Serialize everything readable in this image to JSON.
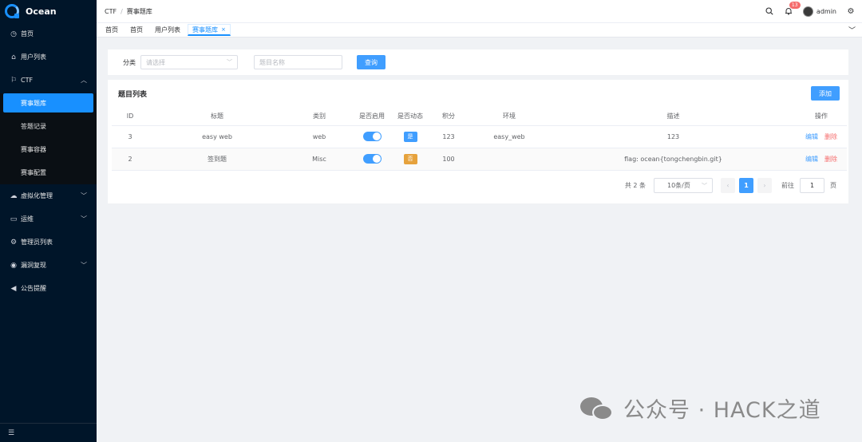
{
  "sidebar": {
    "logo_text": "Ocean",
    "items": [
      {
        "label": "首页",
        "icon": "dashboard-icon"
      },
      {
        "label": "用户列表",
        "icon": "home-icon"
      },
      {
        "label": "CTF",
        "icon": "flag-icon",
        "expanded": true,
        "children": [
          {
            "label": "赛事题库",
            "active": true
          },
          {
            "label": "答题记录"
          },
          {
            "label": "赛事容器"
          },
          {
            "label": "赛事配置"
          }
        ]
      },
      {
        "label": "虚拟化管理",
        "icon": "cloud-icon"
      },
      {
        "label": "运维",
        "icon": "monitor-icon"
      },
      {
        "label": "管理员列表",
        "icon": "gear-icon"
      },
      {
        "label": "漏洞复现",
        "icon": "bug-icon"
      },
      {
        "label": "公告提醒",
        "icon": "megaphone-icon"
      }
    ]
  },
  "header": {
    "breadcrumb": [
      "CTF",
      "赛事题库"
    ],
    "notification_count": "13",
    "username": "admin"
  },
  "tags": [
    {
      "label": "首页"
    },
    {
      "label": "首页"
    },
    {
      "label": "用户列表"
    },
    {
      "label": "赛事题库",
      "active": true,
      "close": "×"
    }
  ],
  "search": {
    "category_label": "分类",
    "category_placeholder": "请选择",
    "name_placeholder": "题目名称",
    "query_button": "查询"
  },
  "table": {
    "title": "题目列表",
    "add_button": "添加",
    "columns": [
      "ID",
      "标题",
      "类别",
      "是否启用",
      "是否动态",
      "积分",
      "环境",
      "描述",
      "操作"
    ],
    "rows": [
      {
        "id": "3",
        "title": "easy web",
        "category": "web",
        "enabled": true,
        "dynamic": "是",
        "score": "123",
        "env": "easy_web",
        "desc": "123",
        "edit": "编辑",
        "delete": "删除"
      },
      {
        "id": "2",
        "title": "签到题",
        "category": "Misc",
        "enabled": true,
        "dynamic": "否",
        "score": "100",
        "env": "",
        "desc": "flag: ocean{tongchengbin.git}",
        "edit": "编辑",
        "delete": "删除"
      }
    ]
  },
  "pagination": {
    "total_text": "共 2 条",
    "page_size": "10条/页",
    "current_page": "1",
    "goto_label": "前往",
    "goto_value": "1",
    "page_suffix": "页"
  },
  "watermark": {
    "text": "公众号 · HACK之道"
  },
  "colors": {
    "sidebar_bg": "#001529",
    "primary": "#409eff",
    "danger": "#f56c6c",
    "warning": "#e6a23c"
  }
}
